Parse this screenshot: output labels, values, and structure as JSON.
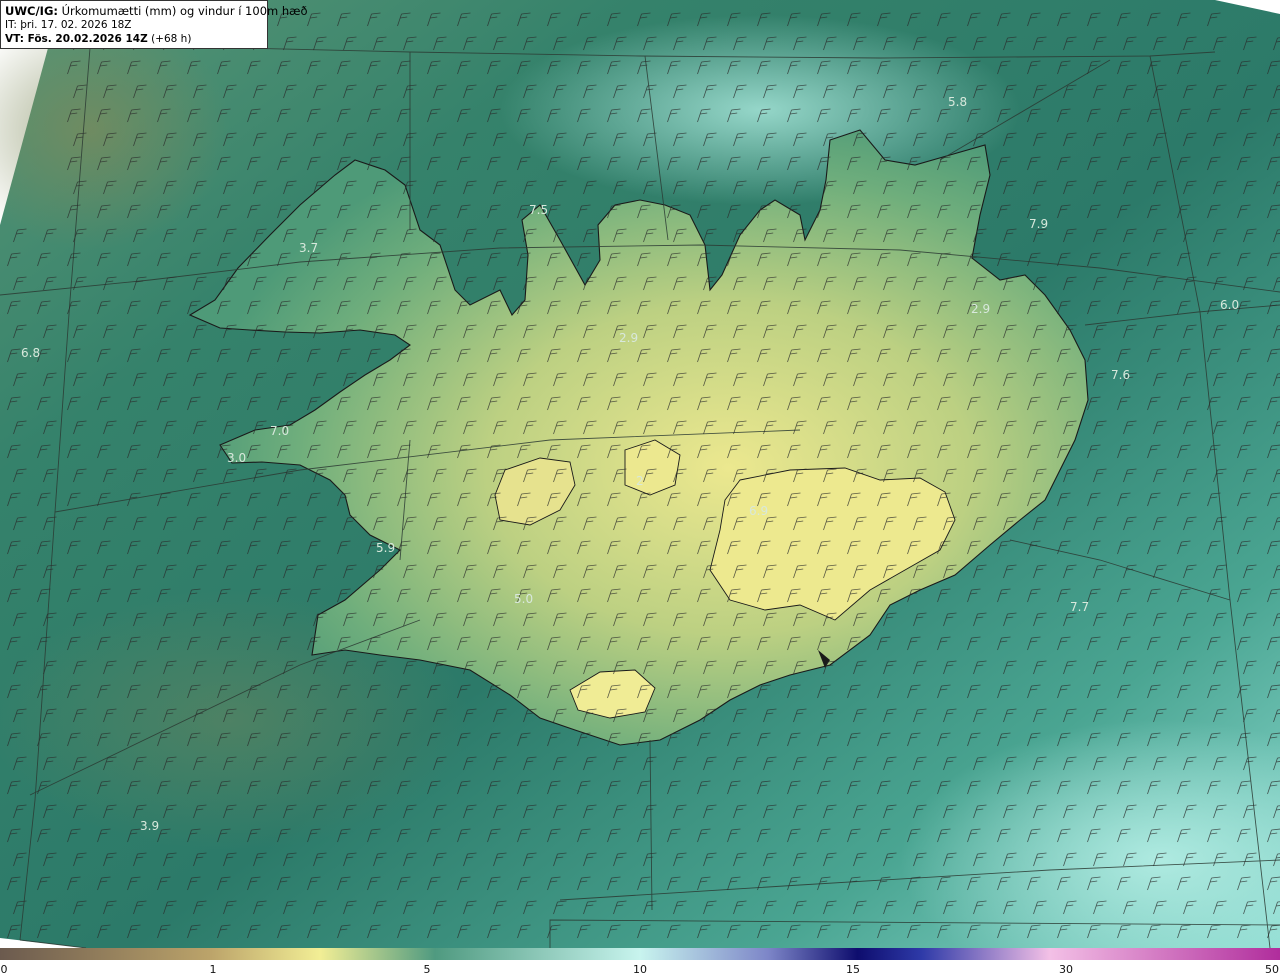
{
  "header": {
    "prefix": "UWC/IG:",
    "title": "Úrkomumætti (mm) og vindur í 100m hæð",
    "init_time": "IT: þri. 17. 02. 2026 18Z",
    "valid_label": "VT: Fös. 20.02.2026 14Z",
    "valid_offset": "(+68 h)"
  },
  "colorbar": {
    "tick_labels": [
      "0",
      "1",
      "5",
      "10",
      "15",
      "30",
      "50"
    ],
    "colors": [
      "#6b5a4e",
      "#bca46a",
      "#f2ee95",
      "#4f9a80",
      "#c8f4ee",
      "#7d86c8",
      "#0e0d6e",
      "#2e3aa8",
      "#f3c0e6",
      "#b02d9c"
    ]
  },
  "map_values": [
    "5.8",
    "7.5",
    "3.7",
    "7.9",
    "6.0",
    "2.9",
    "2.9",
    "6.8",
    "7.6",
    "7.0",
    "3.0",
    "2",
    "6.9",
    "5.9",
    "5.0",
    "7.7",
    "3.9"
  ],
  "colors": {
    "land_high": "#e9e58c",
    "land_mid": "#9fbe7a",
    "sea_green": "#2f7f6b",
    "sea_light": "#93d6c8",
    "coast": "#1a1a1a",
    "barb": "#2a2a2a"
  }
}
